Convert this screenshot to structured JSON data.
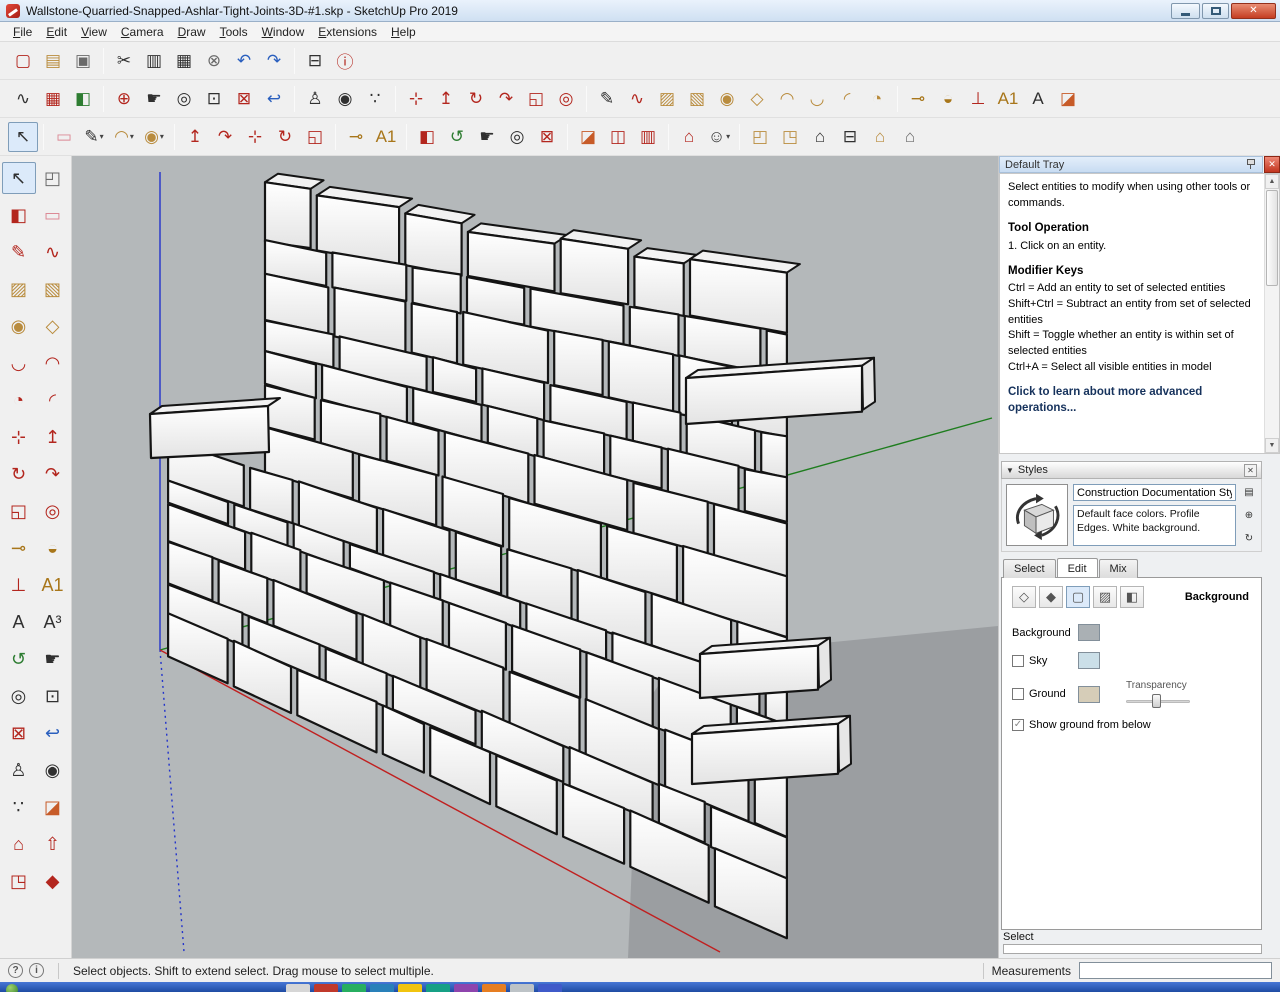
{
  "window": {
    "title": "Wallstone-Quarried-Snapped-Ashlar-Tight-Joints-3D-#1.skp - SketchUp Pro 2019",
    "controls": {
      "close": "✕"
    }
  },
  "menu": {
    "items": [
      "File",
      "Edit",
      "View",
      "Camera",
      "Draw",
      "Tools",
      "Window",
      "Extensions",
      "Help"
    ]
  },
  "palette_colors": {
    "red": "#b3261e",
    "blue": "#2a5fbe",
    "gold": "#a8761a",
    "gray": "#6a6a6a",
    "dark": "#303030",
    "green": "#2e7d32",
    "pink": "#dc8a96",
    "tan": "#b98c3e",
    "orange": "#c75b28"
  },
  "toolbars": {
    "row1": [
      {
        "name": "new-file-icon",
        "glyph": "▢",
        "color": "red"
      },
      {
        "name": "open-file-icon",
        "glyph": "▤",
        "color": "tan"
      },
      {
        "name": "save-icon",
        "glyph": "▣",
        "color": "gray"
      },
      {
        "sep": true
      },
      {
        "name": "cut-icon",
        "glyph": "✂",
        "color": "dark"
      },
      {
        "name": "copy-icon",
        "glyph": "▥",
        "color": "dark"
      },
      {
        "name": "paste-icon",
        "glyph": "▦",
        "color": "dark"
      },
      {
        "name": "delete-icon",
        "glyph": "⊗",
        "color": "gray"
      },
      {
        "name": "undo-icon",
        "glyph": "↶",
        "color": "blue"
      },
      {
        "name": "redo-icon",
        "glyph": "↷",
        "color": "blue"
      },
      {
        "sep": true
      },
      {
        "name": "print-icon",
        "glyph": "⊟",
        "color": "dark"
      },
      {
        "name": "model-info-icon",
        "glyph": "ⓘ",
        "color": "red"
      }
    ],
    "row2": [
      {
        "name": "sketchy-curve-icon",
        "glyph": "∿",
        "color": "dark"
      },
      {
        "name": "generate-report-icon",
        "glyph": "▦",
        "color": "red"
      },
      {
        "name": "paint-bucket-icon",
        "glyph": "◧",
        "color": "green"
      },
      {
        "sep": true
      },
      {
        "name": "move-camera-icon",
        "glyph": "⊕",
        "color": "red"
      },
      {
        "name": "pan-icon",
        "glyph": "☛",
        "color": "dark"
      },
      {
        "name": "zoom-icon",
        "glyph": "◎",
        "color": "dark"
      },
      {
        "name": "zoom-window-icon",
        "glyph": "⊡",
        "color": "dark"
      },
      {
        "name": "zoom-extents-icon",
        "glyph": "⊠",
        "color": "red"
      },
      {
        "name": "zoom-previous-icon",
        "glyph": "↩",
        "color": "blue"
      },
      {
        "sep": true
      },
      {
        "name": "position-camera-icon",
        "glyph": "♙",
        "color": "dark"
      },
      {
        "name": "look-around-icon",
        "glyph": "◉",
        "color": "dark"
      },
      {
        "name": "walk-icon",
        "glyph": "∵",
        "color": "dark"
      },
      {
        "sep": true
      },
      {
        "name": "move-icon",
        "glyph": "⊹",
        "color": "red"
      },
      {
        "name": "push-pull-icon",
        "glyph": "↥",
        "color": "red"
      },
      {
        "name": "rotate-icon",
        "glyph": "↻",
        "color": "red"
      },
      {
        "name": "follow-me-icon",
        "glyph": "↷",
        "color": "red"
      },
      {
        "name": "scale-icon",
        "glyph": "◱",
        "color": "red"
      },
      {
        "name": "offset-icon",
        "glyph": "◎",
        "color": "red"
      },
      {
        "sep": true
      },
      {
        "name": "line-icon",
        "glyph": "✎",
        "color": "dark"
      },
      {
        "name": "freehand-icon",
        "glyph": "∿",
        "color": "red"
      },
      {
        "name": "rectangle-icon",
        "glyph": "▨",
        "color": "tan"
      },
      {
        "name": "rotated-rectangle-icon",
        "glyph": "▧",
        "color": "tan"
      },
      {
        "name": "circle-icon",
        "glyph": "◉",
        "color": "tan"
      },
      {
        "name": "polygon-icon",
        "glyph": "◇",
        "color": "tan"
      },
      {
        "name": "arc-icon",
        "glyph": "◠",
        "color": "tan"
      },
      {
        "name": "two-point-arc-icon",
        "glyph": "◡",
        "color": "tan"
      },
      {
        "name": "three-point-arc-icon",
        "glyph": "◜",
        "color": "tan"
      },
      {
        "name": "pie-icon",
        "glyph": "◔",
        "color": "tan"
      },
      {
        "sep": true
      },
      {
        "name": "tape-measure-icon",
        "glyph": "⊸",
        "color": "gold"
      },
      {
        "name": "protractor-icon",
        "glyph": "◒",
        "color": "gold"
      },
      {
        "name": "axes-icon",
        "glyph": "⊥",
        "color": "red"
      },
      {
        "name": "dimension-icon",
        "glyph": "A1",
        "color": "gold"
      },
      {
        "name": "text-icon",
        "glyph": "A",
        "color": "dark"
      },
      {
        "name": "section-plane-icon",
        "glyph": "◪",
        "color": "orange"
      }
    ],
    "row3": [
      {
        "name": "select-tool-icon",
        "glyph": "↖",
        "color": "dark",
        "pressed": true
      },
      {
        "sep": true
      },
      {
        "name": "eraser-icon",
        "glyph": "▭",
        "color": "pink"
      },
      {
        "name": "line-dropdown-icon",
        "glyph": "✎",
        "color": "dark",
        "dd": true
      },
      {
        "name": "arc-dropdown-icon",
        "glyph": "◠",
        "color": "tan",
        "dd": true
      },
      {
        "name": "shape-dropdown-icon",
        "glyph": "◉",
        "color": "tan",
        "dd": true
      },
      {
        "sep": true
      },
      {
        "name": "push-pull-icon",
        "glyph": "↥",
        "color": "red"
      },
      {
        "name": "follow-me-icon",
        "glyph": "↷",
        "color": "red"
      },
      {
        "name": "move-icon",
        "glyph": "⊹",
        "color": "red"
      },
      {
        "name": "rotate-icon",
        "glyph": "↻",
        "color": "red"
      },
      {
        "name": "scale-icon",
        "glyph": "◱",
        "color": "red"
      },
      {
        "sep": true
      },
      {
        "name": "tape-measure-icon",
        "glyph": "⊸",
        "color": "gold"
      },
      {
        "name": "dimension-icon",
        "glyph": "A1",
        "color": "gold"
      },
      {
        "sep": true
      },
      {
        "name": "paint-bucket-icon",
        "glyph": "◧",
        "color": "red"
      },
      {
        "name": "orbit-icon",
        "glyph": "↺",
        "color": "green"
      },
      {
        "name": "pan-icon",
        "glyph": "☛",
        "color": "dark"
      },
      {
        "name": "zoom-icon",
        "glyph": "◎",
        "color": "dark"
      },
      {
        "name": "zoom-extents-icon",
        "glyph": "⊠",
        "color": "red"
      },
      {
        "sep": true
      },
      {
        "name": "section-plane-icon",
        "glyph": "◪",
        "color": "orange"
      },
      {
        "name": "section-cuts-icon",
        "glyph": "◫",
        "color": "red"
      },
      {
        "name": "section-fill-icon",
        "glyph": "▥",
        "color": "red"
      },
      {
        "sep": true
      },
      {
        "name": "get-models-icon",
        "glyph": "⌂",
        "color": "red"
      },
      {
        "name": "login-dropdown-icon",
        "glyph": "☺",
        "color": "dark",
        "dd": true
      },
      {
        "sep": true
      },
      {
        "name": "component-icon",
        "glyph": "◰",
        "color": "tan"
      },
      {
        "name": "components-icon",
        "glyph": "◳",
        "color": "tan"
      },
      {
        "name": "home-icon",
        "glyph": "⌂",
        "color": "dark"
      },
      {
        "name": "print-model-icon",
        "glyph": "⊟",
        "color": "dark"
      },
      {
        "name": "building-icon",
        "glyph": "⌂",
        "color": "tan"
      },
      {
        "name": "shed-icon",
        "glyph": "⌂",
        "color": "gray"
      }
    ],
    "left": [
      {
        "name": "select-tool-icon",
        "glyph": "↖",
        "color": "dark",
        "pressed": true
      },
      {
        "name": "make-component-icon",
        "glyph": "◰",
        "color": "gray"
      },
      {
        "name": "paint-bucket-icon",
        "glyph": "◧",
        "color": "red"
      },
      {
        "name": "eraser-icon",
        "glyph": "▭",
        "color": "pink"
      },
      {
        "name": "line-icon",
        "glyph": "✎",
        "color": "red"
      },
      {
        "name": "freehand-icon",
        "glyph": "∿",
        "color": "red"
      },
      {
        "name": "rectangle-icon",
        "glyph": "▨",
        "color": "tan"
      },
      {
        "name": "rotated-rectangle-icon",
        "glyph": "▧",
        "color": "tan"
      },
      {
        "name": "circle-icon",
        "glyph": "◉",
        "color": "tan"
      },
      {
        "name": "polygon-icon",
        "glyph": "◇",
        "color": "tan"
      },
      {
        "name": "arc-icon",
        "glyph": "◡",
        "color": "red"
      },
      {
        "name": "two-point-arc-icon",
        "glyph": "◠",
        "color": "red"
      },
      {
        "name": "pie-icon",
        "glyph": "◔",
        "color": "red"
      },
      {
        "name": "three-point-arc-icon",
        "glyph": "◜",
        "color": "red"
      },
      {
        "name": "move-icon",
        "glyph": "⊹",
        "color": "red"
      },
      {
        "name": "push-pull-icon",
        "glyph": "↥",
        "color": "red"
      },
      {
        "name": "rotate-icon",
        "glyph": "↻",
        "color": "red"
      },
      {
        "name": "follow-me-icon",
        "glyph": "↷",
        "color": "red"
      },
      {
        "name": "scale-icon",
        "glyph": "◱",
        "color": "red"
      },
      {
        "name": "offset-icon",
        "glyph": "◎",
        "color": "red"
      },
      {
        "name": "tape-measure-icon",
        "glyph": "⊸",
        "color": "gold"
      },
      {
        "name": "protractor-icon",
        "glyph": "◒",
        "color": "gold"
      },
      {
        "name": "axes-icon",
        "glyph": "⊥",
        "color": "red"
      },
      {
        "name": "dimension-icon",
        "glyph": "A1",
        "color": "gold"
      },
      {
        "name": "text-icon",
        "glyph": "A",
        "color": "dark"
      },
      {
        "name": "three-d-text-icon",
        "glyph": "A³",
        "color": "dark"
      },
      {
        "name": "orbit-icon",
        "glyph": "↺",
        "color": "green"
      },
      {
        "name": "pan-icon",
        "glyph": "☛",
        "color": "dark"
      },
      {
        "name": "zoom-icon",
        "glyph": "◎",
        "color": "dark"
      },
      {
        "name": "zoom-window-icon",
        "glyph": "⊡",
        "color": "dark"
      },
      {
        "name": "zoom-extents-icon",
        "glyph": "⊠",
        "color": "red"
      },
      {
        "name": "zoom-previous-icon",
        "glyph": "↩",
        "color": "blue"
      },
      {
        "name": "position-camera-icon",
        "glyph": "♙",
        "color": "dark"
      },
      {
        "name": "look-around-icon",
        "glyph": "◉",
        "color": "dark"
      },
      {
        "name": "walk-icon",
        "glyph": "∵",
        "color": "dark"
      },
      {
        "name": "section-plane-icon",
        "glyph": "◪",
        "color": "orange"
      },
      {
        "name": "get-models-icon",
        "glyph": "⌂",
        "color": "red"
      },
      {
        "name": "share-model-icon",
        "glyph": "⇧",
        "color": "red"
      },
      {
        "name": "components-icon",
        "glyph": "◳",
        "color": "red"
      },
      {
        "name": "extension-warehouse-icon",
        "glyph": "◆",
        "color": "red"
      }
    ]
  },
  "viewport": {
    "background": "#b4b8ba",
    "shadow": "#9b9ea1",
    "axis_red": "#c02020",
    "axis_green": "#1e7d1e",
    "axis_blue": "#2233cc",
    "block_fill": "#ffffff",
    "block_line": "#141414"
  },
  "tray": {
    "title": "Default Tray",
    "scrollbar": {
      "up": "▲",
      "down": "▼"
    },
    "instructor": {
      "intro": "Select entities to modify when using other tools or commands.",
      "tool_operation_title": "Tool Operation",
      "tool_operation_step": "1. Click on an entity.",
      "modifier_keys_title": "Modifier Keys",
      "modifier_keys": [
        "Ctrl = Add an entity to set of selected entities",
        "Shift+Ctrl = Subtract an entity from set of selected entities",
        "Shift = Toggle whether an entity is within set of selected entities",
        "Ctrl+A = Select all visible entities in model"
      ],
      "advanced_link": "Click to learn about more advanced operations..."
    },
    "styles": {
      "title": "Styles",
      "collapse_arrow": "▼",
      "close_glyph": "✕",
      "name_value": "Construction Documentation Sty",
      "description": "Default face colors. Profile Edges. White background.",
      "side_buttons": [
        {
          "name": "secondary-pane-icon",
          "glyph": "▤"
        },
        {
          "name": "new-style-icon",
          "glyph": "⊕"
        },
        {
          "name": "update-style-icon",
          "glyph": "↻"
        }
      ],
      "tabs": [
        {
          "label": "Select"
        },
        {
          "label": "Edit"
        },
        {
          "label": "Mix"
        }
      ],
      "active_tab": "Edit",
      "settings_icons": [
        {
          "name": "edge-settings-icon",
          "glyph": "◇"
        },
        {
          "name": "face-settings-icon",
          "glyph": "◆"
        },
        {
          "name": "background-settings-icon",
          "glyph": "▢",
          "pressed": true
        },
        {
          "name": "watermark-settings-icon",
          "glyph": "▨"
        },
        {
          "name": "modeling-settings-icon",
          "glyph": "◧"
        }
      ],
      "section_label": "Background",
      "rows": {
        "background_label": "Background",
        "sky_label": "Sky",
        "ground_label": "Ground",
        "transparency_label": "Transparency",
        "show_ground_label": "Show ground from below",
        "show_ground_check": "✓"
      },
      "swatches": {
        "background": "#aab0b4",
        "sky": "#cbdfe8",
        "ground": "#d6cdb8"
      }
    },
    "bottom_label": "Select"
  },
  "statusbar": {
    "icons": [
      {
        "name": "help-icon",
        "glyph": "?"
      },
      {
        "name": "info-icon",
        "glyph": "i"
      }
    ],
    "message": "Select objects. Shift to extend select. Drag mouse to select multiple.",
    "measurements_label": "Measurements",
    "measurements_value": ""
  },
  "taskbar": {
    "icon_colors": [
      "#d6d6d6",
      "#c0392b",
      "#27ae60",
      "#2980b9",
      "#f1c40f",
      "#16a085",
      "#8e44ad",
      "#e67e22",
      "#bdc3c7",
      "#3f5ac9"
    ]
  }
}
